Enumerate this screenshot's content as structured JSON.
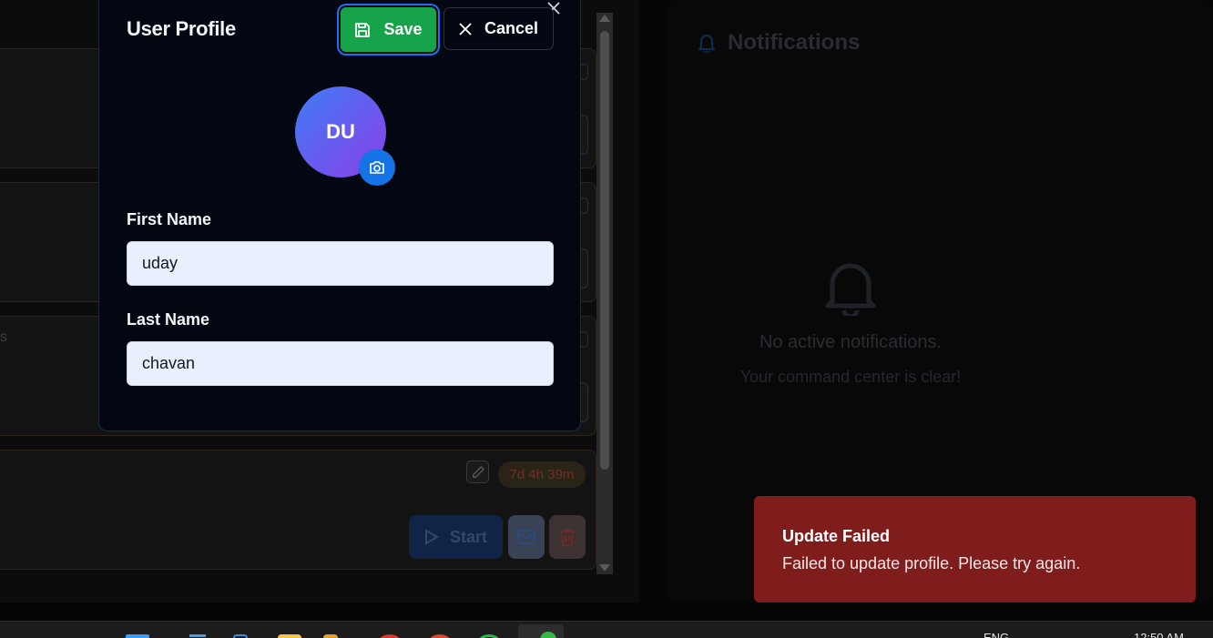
{
  "modal": {
    "title": "User Profile",
    "save_label": "Save",
    "cancel_label": "Cancel",
    "avatar_initials": "DU",
    "first_name_label": "First Name",
    "first_name_value": "uday",
    "last_name_label": "Last Name",
    "last_name_value": "chavan"
  },
  "notifications": {
    "title": "Notifications",
    "empty_title": "No active notifications.",
    "empty_subtitle": "Your command center is clear!"
  },
  "task_card": {
    "stub_text": "s",
    "timer": "7d 4h 39m",
    "start_label": "Start"
  },
  "toast": {
    "title": "Update Failed",
    "message": "Failed to update profile. Please try again."
  },
  "taskbar": {
    "language": "ENG",
    "clock": "12:50 AM"
  },
  "colors": {
    "save_green": "#16a34a",
    "toast_red": "#7f1d1d",
    "avatar_start": "#3f7cf6",
    "avatar_end": "#8b3fe6",
    "camera_blue": "#1473e6"
  },
  "icons": [
    "close-icon",
    "save-icon",
    "x-icon",
    "camera-icon",
    "bell-icon",
    "pencil-icon",
    "play-icon",
    "mail-icon",
    "trash-icon",
    "windows-icon"
  ]
}
